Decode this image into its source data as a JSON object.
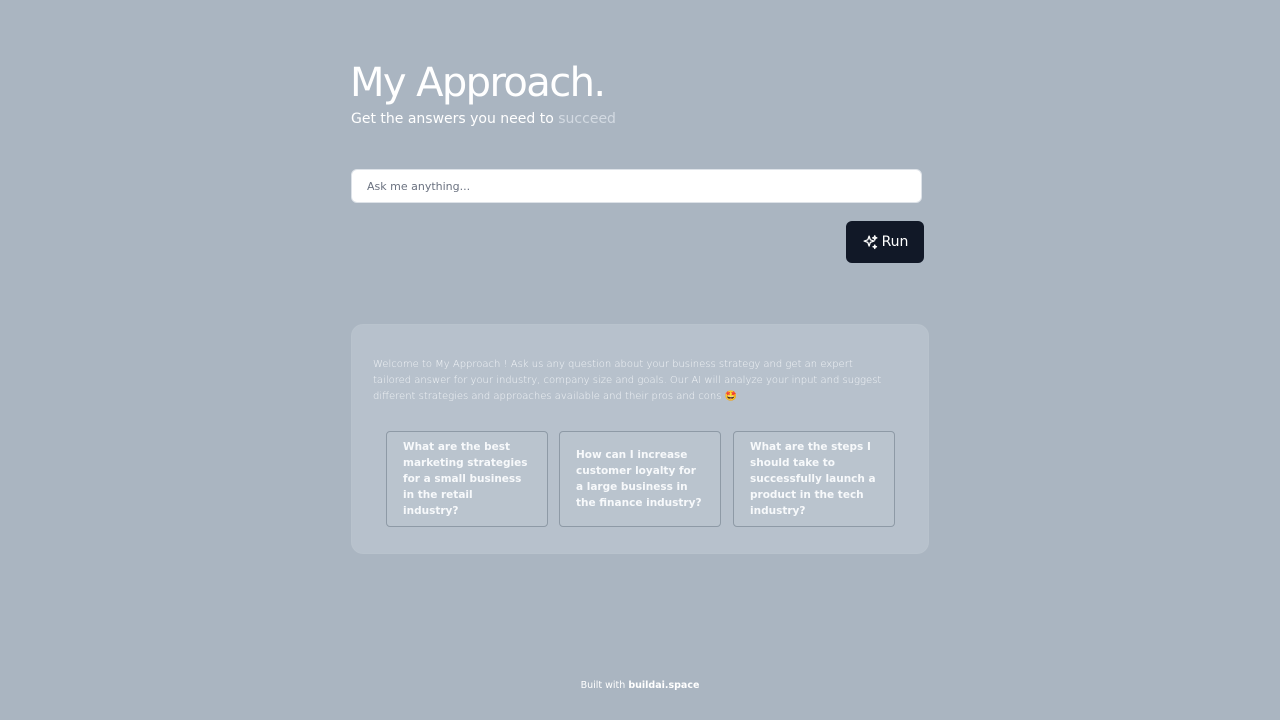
{
  "header": {
    "title": "My Approach.",
    "subtitle_prefix": "Get the answers you need to ",
    "subtitle_accent": "succeed"
  },
  "search": {
    "placeholder": "Ask me anything...",
    "value": ""
  },
  "run_button": {
    "label": "Run",
    "icon": "sparkles-icon"
  },
  "card": {
    "welcome_text": "Welcome to My Approach ! Ask us any question about your business strategy and get an expert tailored answer for your industry, company size and goals. Our AI will analyze your input and suggest different strategies and approaches available and their pros and cons 🤩",
    "suggestions": [
      "What are the best marketing strategies for a small business in the retail industry?",
      "How can I increase customer loyalty for a large business in the finance industry?",
      "What are the steps I should take to successfully launch a product in the tech industry?"
    ]
  },
  "footer": {
    "prefix": "Built with ",
    "link": "buildai.space"
  },
  "colors": {
    "background": "#aab5c1",
    "button_bg": "#111827",
    "card_bg": "#b7c1cc"
  }
}
